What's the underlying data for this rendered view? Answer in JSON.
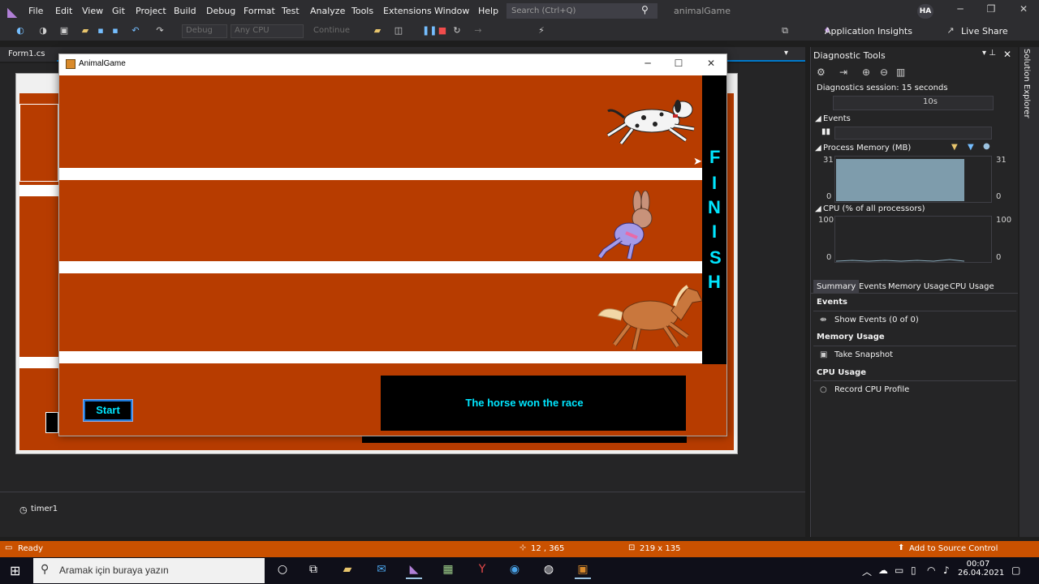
{
  "menu": [
    "File",
    "Edit",
    "View",
    "Git",
    "Project",
    "Build",
    "Debug",
    "Format",
    "Test",
    "Analyze",
    "Tools",
    "Extensions",
    "Window",
    "Help"
  ],
  "search": {
    "placeholder": "Search (Ctrl+Q)"
  },
  "solution_name": "animalGame",
  "user_initials": "HA",
  "toolbar": {
    "config": "Debug",
    "platform": "Any CPU",
    "continue_label": "Continue",
    "app_insights": "Application Insights",
    "live_share": "Live Share"
  },
  "doc_tab": "Form1.cs",
  "designer": {
    "tray_component": "timer1"
  },
  "app": {
    "title": "AnimalGame",
    "finish_letters": [
      "F",
      "I",
      "N",
      "I",
      "S",
      "H"
    ],
    "start_label": "Start",
    "result": "The horse won the race",
    "animals": [
      "dalmatian-dog",
      "rabbit",
      "horse"
    ],
    "colors": {
      "track": "#b73c00",
      "finish": "#000000",
      "text": "#00e6ff"
    }
  },
  "diagnostics": {
    "title": "Diagnostic Tools",
    "session": "Diagnostics session: 15 seconds",
    "timeline_tick": "10s",
    "events_label": "Events",
    "memory_label": "Process Memory (MB)",
    "memory_max": "31",
    "memory_min": "0",
    "cpu_label": "CPU (% of all processors)",
    "cpu_max": "100",
    "cpu_min": "0",
    "tabs": [
      "Summary",
      "Events",
      "Memory Usage",
      "CPU Usage"
    ],
    "summary": {
      "events_head": "Events",
      "show_events": "Show Events (0 of 0)",
      "memory_head": "Memory Usage",
      "take_snapshot": "Take Snapshot",
      "cpu_head": "CPU Usage",
      "record_cpu": "Record CPU Profile"
    }
  },
  "solution_explorer": "Solution Explorer",
  "status": {
    "ready": "Ready",
    "position": "12 , 365",
    "size": "219 x 135",
    "source_control": "Add to Source Control"
  },
  "taskbar": {
    "search_placeholder": "Aramak için buraya yazın",
    "time": "00:07",
    "date": "26.04.2021"
  }
}
